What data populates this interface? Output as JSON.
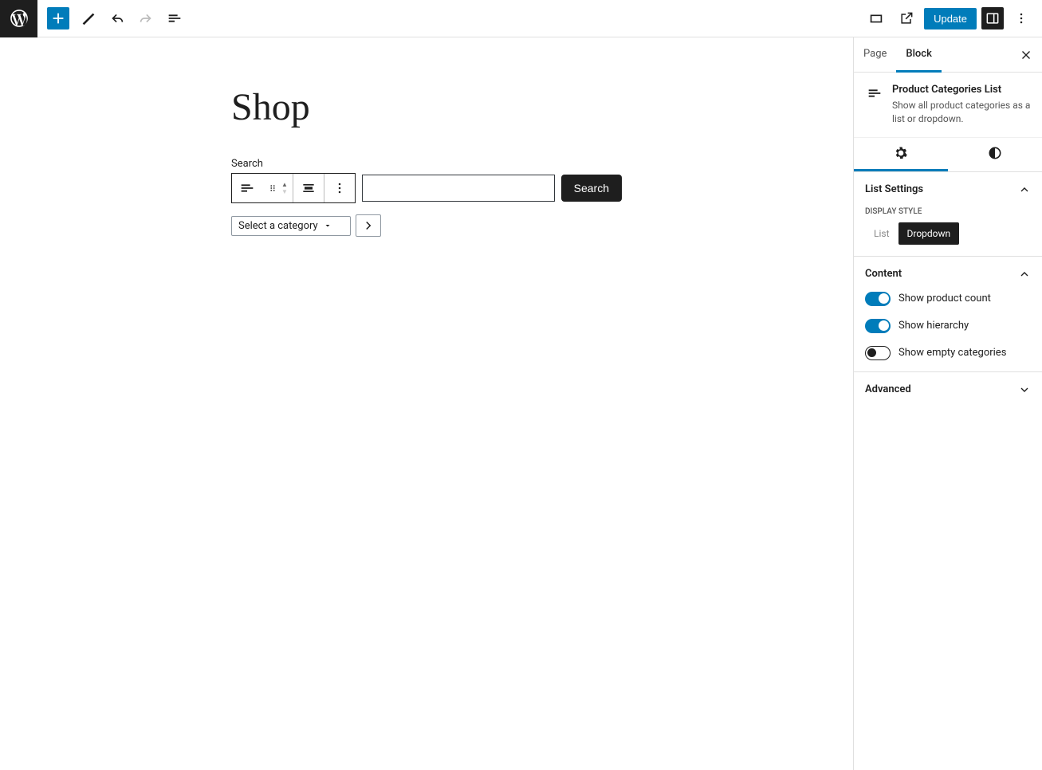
{
  "topbar": {
    "update": "Update"
  },
  "page": {
    "title": "Shop",
    "search_label": "Search",
    "search_button": "Search",
    "category_placeholder": "Select a category"
  },
  "sidebar": {
    "tabs": {
      "page": "Page",
      "block": "Block"
    },
    "block": {
      "title": "Product Categories List",
      "description": "Show all product categories as a list or dropdown."
    },
    "list_settings": {
      "title": "List Settings",
      "display_style_label": "DISPLAY STYLE",
      "options": {
        "list": "List",
        "dropdown": "Dropdown"
      }
    },
    "content": {
      "title": "Content",
      "show_product_count": "Show product count",
      "show_hierarchy": "Show hierarchy",
      "show_empty": "Show empty categories"
    },
    "advanced": "Advanced"
  }
}
